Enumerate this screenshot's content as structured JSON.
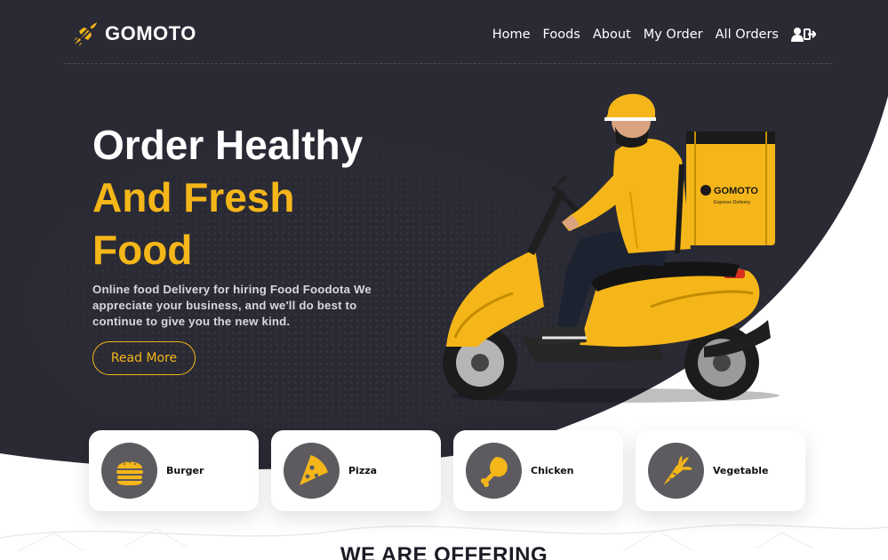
{
  "brand": {
    "name": "GOMOTO",
    "accent": "#f5b619",
    "dark": "#2a2a35"
  },
  "nav": {
    "items": [
      "Home",
      "Foods",
      "About",
      "My Order",
      "All Orders"
    ],
    "account_icon": "user-logout-icon"
  },
  "hero": {
    "line1": "Order Healthy",
    "line2": "And Fresh",
    "line3": "Food",
    "description": "Online food Delivery for hiring Food Foodota We appreciate your business, and we'll do best to continue to give you the new kind.",
    "button_label": "Read More",
    "bag_brand": "GOMOTO",
    "bag_tagline": "Express Delivery"
  },
  "categories": [
    {
      "label": "Burger",
      "icon": "burger-icon"
    },
    {
      "label": "Pizza",
      "icon": "pizza-icon"
    },
    {
      "label": "Chicken",
      "icon": "chicken-icon"
    },
    {
      "label": "Vegetable",
      "icon": "carrot-icon"
    }
  ],
  "section": {
    "title": "WE ARE OFFERING"
  }
}
